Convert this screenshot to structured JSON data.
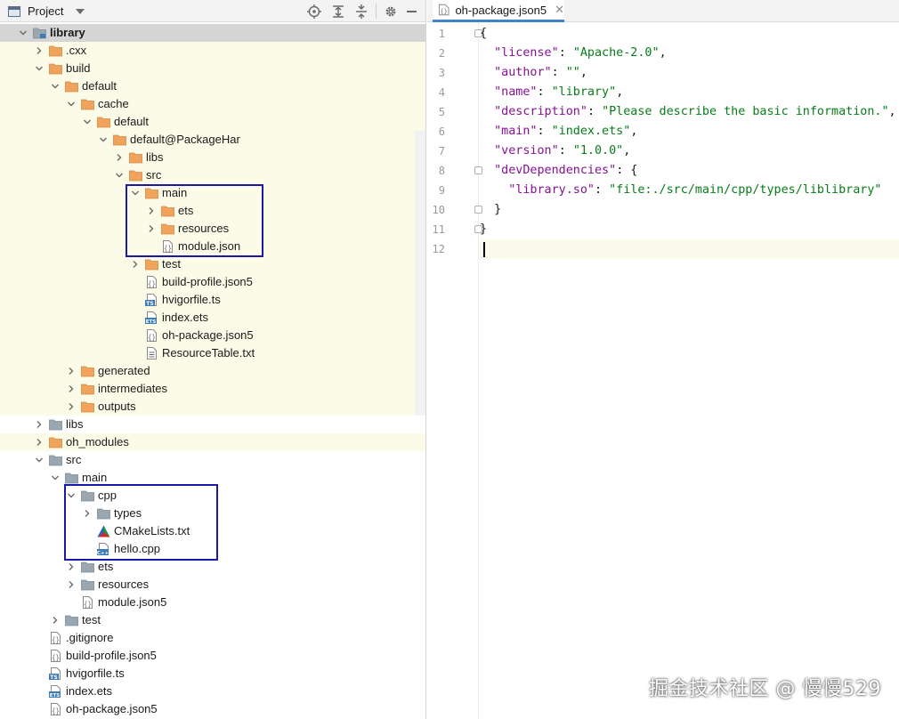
{
  "project_panel": {
    "title": "Project",
    "icons": {
      "view": "project-view-icon",
      "dropdown": "chevron-down-icon",
      "locate": "locate-icon",
      "expand": "expand-all-icon",
      "collapse": "collapse-all-icon",
      "settings": "gear-icon",
      "hide": "minimize-icon"
    }
  },
  "tree": [
    {
      "label": "library",
      "depth": 0,
      "expand": "open",
      "icon": "module",
      "bold": true,
      "bg": "selected"
    },
    {
      "label": ".cxx",
      "depth": 1,
      "expand": "closed",
      "icon": "folder-orange",
      "bg": "excluded"
    },
    {
      "label": "build",
      "depth": 1,
      "expand": "open",
      "icon": "folder-orange",
      "bg": "excluded"
    },
    {
      "label": "default",
      "depth": 2,
      "expand": "open",
      "icon": "folder-orange",
      "bg": "excluded"
    },
    {
      "label": "cache",
      "depth": 3,
      "expand": "open",
      "icon": "folder-orange",
      "bg": "excluded"
    },
    {
      "label": "default",
      "depth": 4,
      "expand": "open",
      "icon": "folder-orange",
      "bg": "excluded"
    },
    {
      "label": "default@PackageHar",
      "depth": 5,
      "expand": "open",
      "icon": "folder-orange",
      "bg": "indent-cut"
    },
    {
      "label": "libs",
      "depth": 6,
      "expand": "closed",
      "icon": "folder-orange",
      "bg": "indent-cut"
    },
    {
      "label": "src",
      "depth": 6,
      "expand": "open",
      "icon": "folder-orange",
      "bg": "indent-cut"
    },
    {
      "label": "main",
      "depth": 7,
      "expand": "open",
      "icon": "folder-orange",
      "bg": "indent-cut"
    },
    {
      "label": "ets",
      "depth": 8,
      "expand": "closed",
      "icon": "folder-orange",
      "bg": "indent-cut"
    },
    {
      "label": "resources",
      "depth": 8,
      "expand": "closed",
      "icon": "folder-orange",
      "bg": "indent-cut"
    },
    {
      "label": "module.json",
      "depth": 8,
      "expand": "none",
      "icon": "json-file",
      "bg": "indent-cut"
    },
    {
      "label": "test",
      "depth": 7,
      "expand": "closed",
      "icon": "folder-orange",
      "bg": "indent-cut"
    },
    {
      "label": "build-profile.json5",
      "depth": 7,
      "expand": "none",
      "icon": "json-file",
      "bg": "indent-cut"
    },
    {
      "label": "hvigorfile.ts",
      "depth": 7,
      "expand": "none",
      "icon": "ts-file",
      "bg": "indent-cut"
    },
    {
      "label": "index.ets",
      "depth": 7,
      "expand": "none",
      "icon": "ets-file",
      "bg": "indent-cut"
    },
    {
      "label": "oh-package.json5",
      "depth": 7,
      "expand": "none",
      "icon": "json-file",
      "bg": "indent-cut"
    },
    {
      "label": "ResourceTable.txt",
      "depth": 7,
      "expand": "none",
      "icon": "text-file",
      "bg": "indent-cut"
    },
    {
      "label": "generated",
      "depth": 3,
      "expand": "closed",
      "icon": "folder-orange",
      "bg": "indent-cut"
    },
    {
      "label": "intermediates",
      "depth": 3,
      "expand": "closed",
      "icon": "folder-orange",
      "bg": "indent-cut"
    },
    {
      "label": "outputs",
      "depth": 3,
      "expand": "closed",
      "icon": "folder-orange",
      "bg": "indent-cut"
    },
    {
      "label": "libs",
      "depth": 1,
      "expand": "closed",
      "icon": "folder-gray",
      "bg": "none"
    },
    {
      "label": "oh_modules",
      "depth": 1,
      "expand": "closed",
      "icon": "folder-orange",
      "bg": "excluded"
    },
    {
      "label": "src",
      "depth": 1,
      "expand": "open",
      "icon": "folder-gray",
      "bg": "none"
    },
    {
      "label": "main",
      "depth": 2,
      "expand": "open",
      "icon": "folder-gray",
      "bg": "none"
    },
    {
      "label": "cpp",
      "depth": 3,
      "expand": "open",
      "icon": "folder-gray",
      "bg": "none"
    },
    {
      "label": "types",
      "depth": 4,
      "expand": "closed",
      "icon": "folder-gray",
      "bg": "none"
    },
    {
      "label": "CMakeLists.txt",
      "depth": 4,
      "expand": "none",
      "icon": "cmake-file",
      "bg": "none"
    },
    {
      "label": "hello.cpp",
      "depth": 4,
      "expand": "none",
      "icon": "cpp-file",
      "bg": "none"
    },
    {
      "label": "ets",
      "depth": 3,
      "expand": "closed",
      "icon": "folder-gray",
      "bg": "none"
    },
    {
      "label": "resources",
      "depth": 3,
      "expand": "closed",
      "icon": "folder-gray",
      "bg": "none"
    },
    {
      "label": "module.json5",
      "depth": 3,
      "expand": "none",
      "icon": "json-file",
      "bg": "none"
    },
    {
      "label": "test",
      "depth": 2,
      "expand": "closed",
      "icon": "folder-gray",
      "bg": "none"
    },
    {
      "label": ".gitignore",
      "depth": 1,
      "expand": "none",
      "icon": "json-file",
      "bg": "none"
    },
    {
      "label": "build-profile.json5",
      "depth": 1,
      "expand": "none",
      "icon": "json-file",
      "bg": "none"
    },
    {
      "label": "hvigorfile.ts",
      "depth": 1,
      "expand": "none",
      "icon": "ts-file",
      "bg": "none"
    },
    {
      "label": "index.ets",
      "depth": 1,
      "expand": "none",
      "icon": "ets-file",
      "bg": "none"
    },
    {
      "label": "oh-package.json5",
      "depth": 1,
      "expand": "none",
      "icon": "json-file",
      "bg": "none"
    }
  ],
  "editor": {
    "tab_label": "oh-package.json5",
    "tab_icon": "json-file-icon",
    "close_icon": "close-icon",
    "line_numbers": [
      "1",
      "2",
      "3",
      "4",
      "5",
      "6",
      "7",
      "8",
      "9",
      "10",
      "11",
      "12"
    ],
    "lines": [
      [
        {
          "t": "p",
          "v": "{"
        }
      ],
      [
        {
          "t": "p",
          "v": "  "
        },
        {
          "t": "k",
          "v": "\"license\""
        },
        {
          "t": "p",
          "v": ": "
        },
        {
          "t": "s",
          "v": "\"Apache-2.0\""
        },
        {
          "t": "p",
          "v": ","
        }
      ],
      [
        {
          "t": "p",
          "v": "  "
        },
        {
          "t": "k",
          "v": "\"author\""
        },
        {
          "t": "p",
          "v": ": "
        },
        {
          "t": "s",
          "v": "\"\""
        },
        {
          "t": "p",
          "v": ","
        }
      ],
      [
        {
          "t": "p",
          "v": "  "
        },
        {
          "t": "k",
          "v": "\"name\""
        },
        {
          "t": "p",
          "v": ": "
        },
        {
          "t": "s",
          "v": "\"library\""
        },
        {
          "t": "p",
          "v": ","
        }
      ],
      [
        {
          "t": "p",
          "v": "  "
        },
        {
          "t": "k",
          "v": "\"description\""
        },
        {
          "t": "p",
          "v": ": "
        },
        {
          "t": "s",
          "v": "\"Please describe the basic information.\""
        },
        {
          "t": "p",
          "v": ","
        }
      ],
      [
        {
          "t": "p",
          "v": "  "
        },
        {
          "t": "k",
          "v": "\"main\""
        },
        {
          "t": "p",
          "v": ": "
        },
        {
          "t": "s",
          "v": "\"index.ets\""
        },
        {
          "t": "p",
          "v": ","
        }
      ],
      [
        {
          "t": "p",
          "v": "  "
        },
        {
          "t": "k",
          "v": "\"version\""
        },
        {
          "t": "p",
          "v": ": "
        },
        {
          "t": "s",
          "v": "\"1.0.0\""
        },
        {
          "t": "p",
          "v": ","
        }
      ],
      [
        {
          "t": "p",
          "v": "  "
        },
        {
          "t": "k",
          "v": "\"devDependencies\""
        },
        {
          "t": "p",
          "v": ": {"
        }
      ],
      [
        {
          "t": "p",
          "v": "    "
        },
        {
          "t": "k",
          "v": "\"library.so\""
        },
        {
          "t": "p",
          "v": ": "
        },
        {
          "t": "s",
          "v": "\"file:./src/main/cpp/types/liblibrary\""
        }
      ],
      [
        {
          "t": "p",
          "v": "  }"
        }
      ],
      [
        {
          "t": "p",
          "v": "}"
        }
      ],
      []
    ],
    "current_line": 12
  },
  "watermark": "掘金技术社区 @ 慢慢529",
  "colors": {
    "accent": "#4083c9",
    "folder_orange": "#f0a35a",
    "folder_gray": "#9aa7b0",
    "highlight_box": "#1a1aaa",
    "key": "#871094",
    "string": "#067d17"
  }
}
